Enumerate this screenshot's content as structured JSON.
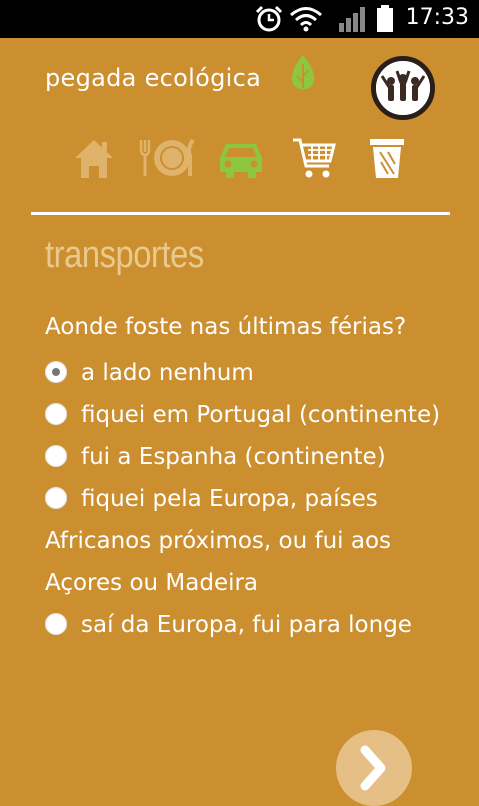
{
  "status_bar": {
    "time": "17:33"
  },
  "app": {
    "logo_text": "pegada ecológica"
  },
  "categories": [
    {
      "name": "home-icon",
      "active": false
    },
    {
      "name": "food-icon",
      "active": false
    },
    {
      "name": "car-icon",
      "active": true
    },
    {
      "name": "cart-icon",
      "active": false
    },
    {
      "name": "trash-icon",
      "active": false
    }
  ],
  "section": {
    "title": "transportes"
  },
  "question": {
    "text": "Aonde foste nas últimas férias?",
    "options": [
      {
        "label": "a lado nenhum",
        "checked": true
      },
      {
        "label": "fiquei em Portugal (continente)",
        "checked": false
      },
      {
        "label": "fui a Espanha (continente)",
        "checked": false
      },
      {
        "label": "fiquei pela Europa, países Africanos próximos, ou fui aos Açores ou Madeira",
        "checked": false
      },
      {
        "label": "saí da Europa, fui para longe",
        "checked": false
      }
    ]
  },
  "colors": {
    "background": "#CB8F2F",
    "title": "#E9C98E",
    "active_icon": "#8DC63F",
    "inactive_icon": "#E0B36C"
  }
}
